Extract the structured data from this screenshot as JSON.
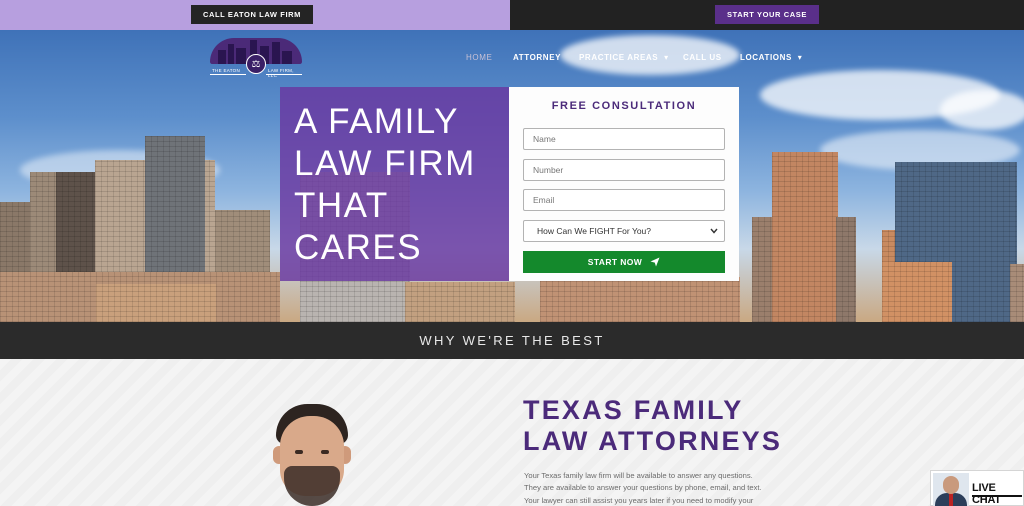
{
  "topbar": {
    "call_label": "CALL EATON LAW FIRM",
    "start_case_label": "START YOUR CASE"
  },
  "logo": {
    "left_text": "THE EATON",
    "right_text": "LAW FIRM, LLC"
  },
  "nav": {
    "items": [
      {
        "label": "HOME",
        "active": true,
        "dropdown": false
      },
      {
        "label": "ATTORNEY",
        "active": false,
        "dropdown": false
      },
      {
        "label": "PRACTICE AREAS",
        "active": false,
        "dropdown": true
      },
      {
        "label": "CALL US",
        "active": false,
        "dropdown": false
      },
      {
        "label": "LOCATIONS",
        "active": false,
        "dropdown": true
      }
    ],
    "dropdown_glyph": "▾"
  },
  "hero": {
    "title_lines": [
      "A FAMILY",
      "LAW FIRM",
      "THAT",
      "CARES"
    ]
  },
  "form": {
    "title": "FREE CONSULTATION",
    "name_placeholder": "Name",
    "number_placeholder": "Number",
    "email_placeholder": "Email",
    "select_value": "How Can We FIGHT For You?",
    "submit_label": "START NOW"
  },
  "why": {
    "label": "WHY WE'RE THE BEST"
  },
  "about": {
    "headline_lines": [
      "TEXAS FAMILY",
      "LAW ATTORNEYS"
    ],
    "paragraph_lines": [
      "Your Texas family law firm will be available to answer any questions.",
      "They are available to answer your questions by phone, email, and text.",
      "Your lawyer can still assist you years later if you need to modify your"
    ]
  },
  "chat": {
    "label": "LIVE CHAT"
  },
  "colors": {
    "brand_purple": "#4b2a7a",
    "accent_purple": "#5a2f8a",
    "topbar_lavender": "#b79fdf",
    "submit_green": "#14892c",
    "dark_band": "#2b2b2b"
  },
  "icons": {
    "send": "paper-plane-icon",
    "select_arrow": "chevron-down-icon",
    "logo_emblem": "scales-of-justice-icon"
  }
}
